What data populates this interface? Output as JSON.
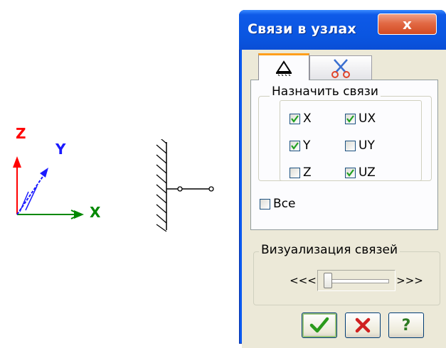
{
  "axes": {
    "z_label": "Z",
    "y_label": "Y",
    "x_label": "X"
  },
  "window": {
    "title": "Связи в узлах",
    "close_label": "x"
  },
  "tabs": [
    {
      "icon": "support-icon",
      "active": true
    },
    {
      "icon": "scissors-icon",
      "active": false
    }
  ],
  "assign": {
    "title": "Назначить связи",
    "checkboxes": [
      {
        "label": "X",
        "checked": true
      },
      {
        "label": "UX",
        "checked": true
      },
      {
        "label": "Y",
        "checked": true
      },
      {
        "label": "UY",
        "checked": false
      },
      {
        "label": "Z",
        "checked": false
      },
      {
        "label": "UZ",
        "checked": true
      }
    ],
    "all": {
      "label": "Все",
      "checked": false
    }
  },
  "visualization": {
    "title": "Визуализация связей",
    "decrease": "<<<",
    "increase": ">>>"
  },
  "buttons": {
    "help": "?"
  },
  "colors": {
    "title_bar": "#0a55e0",
    "close_button": "#d24a22",
    "dialog_face": "#ece9d8",
    "check": "#21a121",
    "z_axis": "#ff0000",
    "y_axis": "#1a1aff",
    "x_axis": "#008800"
  }
}
